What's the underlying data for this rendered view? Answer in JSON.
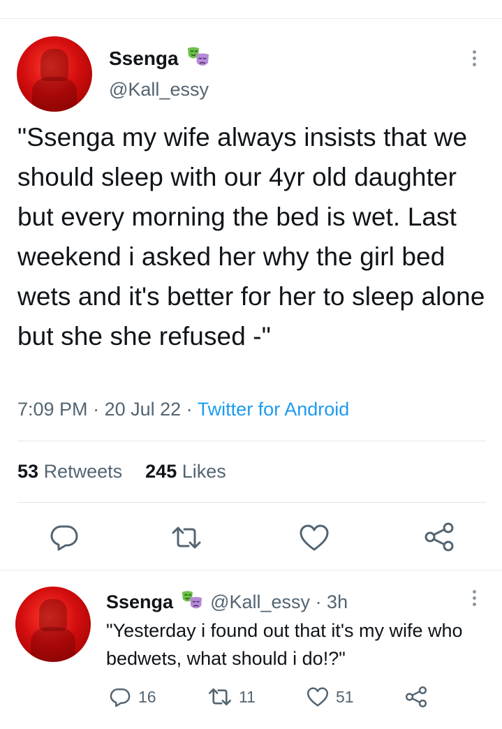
{
  "main_tweet": {
    "author_name": "Ssenga",
    "author_handle": "@Kall_essy",
    "author_emoji": "theater-masks-emoji",
    "text": "\"Ssenga my wife always insists that we should sleep with our 4yr old daughter but every morning the bed is wet. Last weekend i asked her why the girl bed wets and it's better for her to sleep alone but she she refused -\"",
    "time": "7:09 PM",
    "dot1": " · ",
    "date": "20 Jul 22",
    "dot2": " · ",
    "source": "Twitter for Android",
    "retweets_count": "53",
    "retweets_label": "Retweets",
    "likes_count": "245",
    "likes_label": "Likes"
  },
  "reply_tweet": {
    "author_name": "Ssenga",
    "author_handle": "@Kall_essy",
    "age": "· 3h",
    "text": "\"Yesterday i found out that it's my wife who bedwets, what should i do!?\"",
    "replies": "16",
    "retweets": "11",
    "likes": "51"
  },
  "colors": {
    "accent": "#1d9bf0",
    "secondary_text": "#536471",
    "icon": "#536471",
    "avatar": "#d40e0e"
  }
}
